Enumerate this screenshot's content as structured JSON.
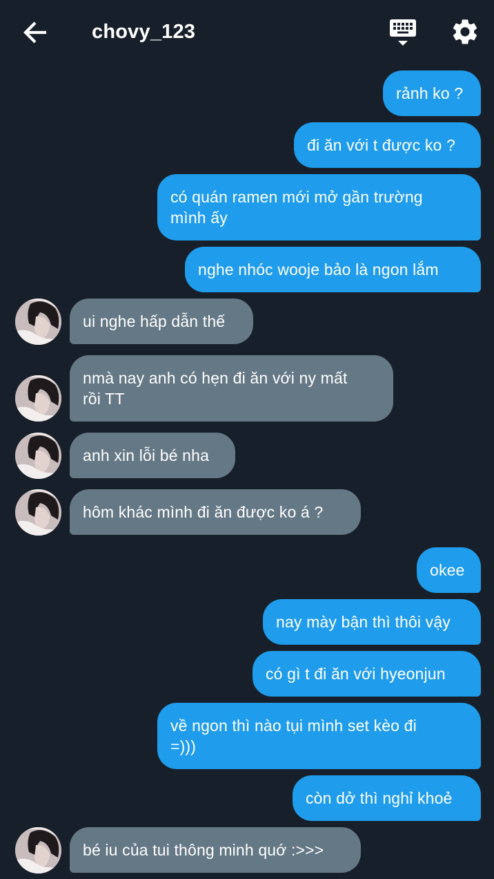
{
  "header": {
    "title": "chovy_123",
    "back_icon": "arrow-left-icon",
    "keyboard_icon": "keyboard-icon",
    "settings_icon": "gear-icon"
  },
  "colors": {
    "background": "#17202a",
    "outgoing_bubble": "#1f9ceb",
    "incoming_bubble": "#657885",
    "text": "#ffffff"
  },
  "messages": [
    {
      "from": "me",
      "line1": "rảnh ko ?",
      "line2": ""
    },
    {
      "from": "me",
      "line1": "đi ăn với t được ko ?",
      "line2": ""
    },
    {
      "from": "me",
      "line1": "có quán ramen mới mở gần trường",
      "line2": "mình ấy"
    },
    {
      "from": "me",
      "line1": "nghe nhóc wooje bảo là ngon lắm",
      "line2": ""
    },
    {
      "from": "chovy_123",
      "line1": "ui nghe hấp dẫn thế",
      "line2": ""
    },
    {
      "from": "chovy_123",
      "line1": "nmà nay anh có hẹn đi ăn với ny mất",
      "line2": "rồi TT"
    },
    {
      "from": "chovy_123",
      "line1": "anh xin lỗi bé nha",
      "line2": ""
    },
    {
      "from": "chovy_123",
      "line1": "hôm khác mình đi ăn được ko á ?",
      "line2": ""
    },
    {
      "from": "me",
      "line1": "okee",
      "line2": ""
    },
    {
      "from": "me",
      "line1": "nay mày bận thì thôi vậy",
      "line2": ""
    },
    {
      "from": "me",
      "line1": "có gì t đi ăn với hyeonjun",
      "line2": ""
    },
    {
      "from": "me",
      "line1": "về ngon thì nào tụi mình set kèo đi",
      "line2": "=)))"
    },
    {
      "from": "me",
      "line1": "còn dở thì nghỉ khoẻ",
      "line2": ""
    },
    {
      "from": "chovy_123",
      "line1": "bé iu của tui thông minh quớ :>>>",
      "line2": ""
    }
  ]
}
